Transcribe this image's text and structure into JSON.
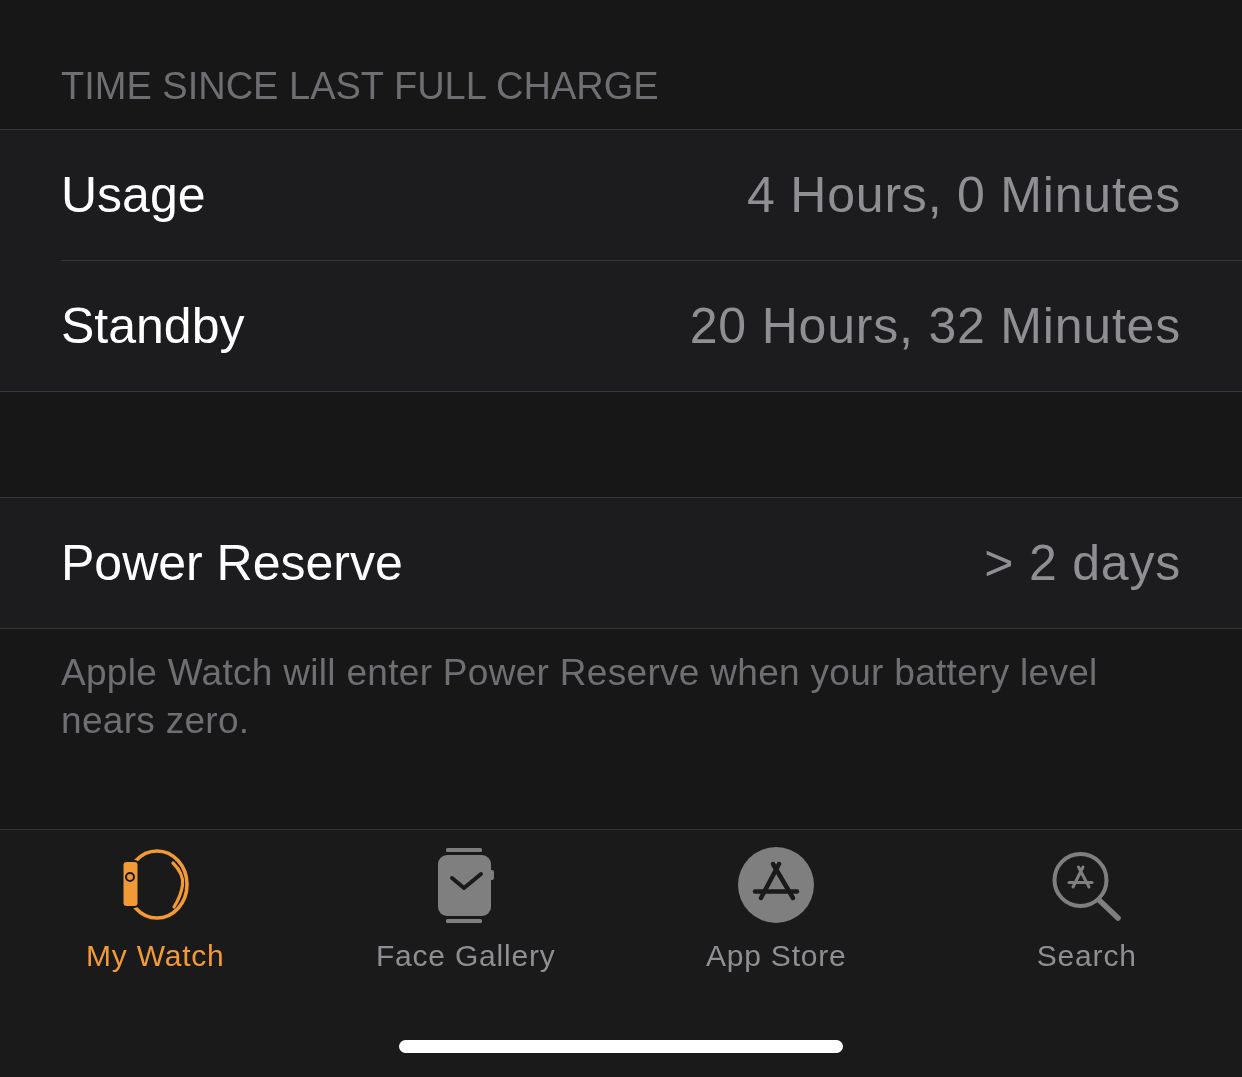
{
  "section_header": "TIME SINCE LAST FULL CHARGE",
  "time_rows": [
    {
      "label": "Usage",
      "value": "4 Hours, 0 Minutes"
    },
    {
      "label": "Standby",
      "value": "20 Hours, 32 Minutes"
    }
  ],
  "power_reserve": {
    "label": "Power Reserve",
    "value": "> 2 days"
  },
  "footer_note": "Apple Watch will enter Power Reserve when your battery level nears zero.",
  "tab_bar": [
    {
      "label": "My Watch",
      "kind": "watch",
      "selected": true
    },
    {
      "label": "Face Gallery",
      "kind": "face",
      "selected": false
    },
    {
      "label": "App Store",
      "kind": "store",
      "selected": false
    },
    {
      "label": "Search",
      "kind": "search",
      "selected": false
    }
  ]
}
